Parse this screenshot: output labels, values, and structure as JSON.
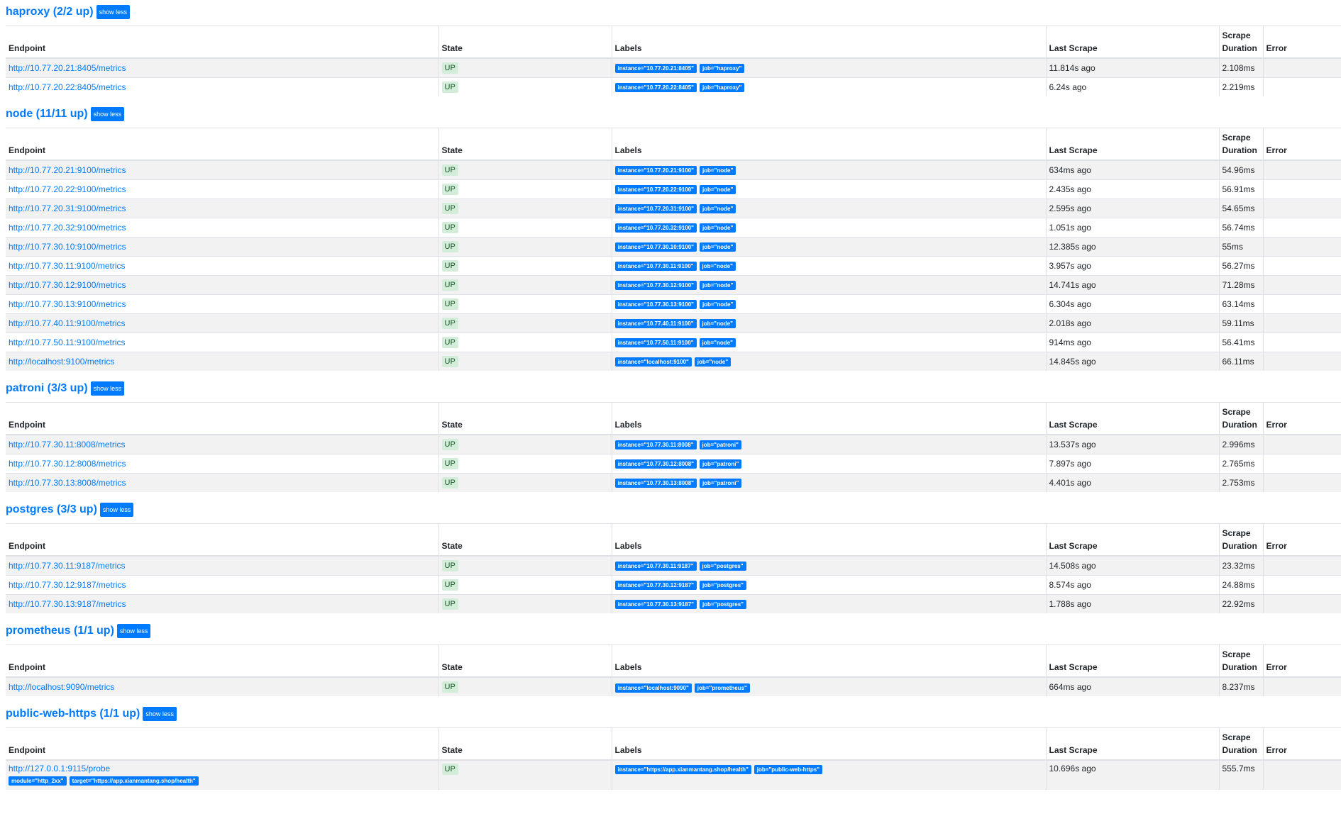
{
  "headers": {
    "endpoint": "Endpoint",
    "state": "State",
    "labels": "Labels",
    "last_scrape": "Last Scrape",
    "scrape_duration": "Scrape Duration",
    "error": "Error"
  },
  "toggle_label": "show less",
  "jobs": [
    {
      "title": "haproxy (2/2 up)",
      "rows": [
        {
          "endpoint": "http://10.77.20.21:8405/metrics",
          "state": "UP",
          "labels": [
            "instance=\"10.77.20.21:8405\"",
            "job=\"haproxy\""
          ],
          "last": "11.814s ago",
          "dur": "2.108ms"
        },
        {
          "endpoint": "http://10.77.20.22:8405/metrics",
          "state": "UP",
          "labels": [
            "instance=\"10.77.20.22:8405\"",
            "job=\"haproxy\""
          ],
          "last": "6.24s ago",
          "dur": "2.219ms"
        }
      ]
    },
    {
      "title": "node (11/11 up)",
      "rows": [
        {
          "endpoint": "http://10.77.20.21:9100/metrics",
          "state": "UP",
          "labels": [
            "instance=\"10.77.20.21:9100\"",
            "job=\"node\""
          ],
          "last": "634ms ago",
          "dur": "54.96ms"
        },
        {
          "endpoint": "http://10.77.20.22:9100/metrics",
          "state": "UP",
          "labels": [
            "instance=\"10.77.20.22:9100\"",
            "job=\"node\""
          ],
          "last": "2.435s ago",
          "dur": "56.91ms"
        },
        {
          "endpoint": "http://10.77.20.31:9100/metrics",
          "state": "UP",
          "labels": [
            "instance=\"10.77.20.31:9100\"",
            "job=\"node\""
          ],
          "last": "2.595s ago",
          "dur": "54.65ms"
        },
        {
          "endpoint": "http://10.77.20.32:9100/metrics",
          "state": "UP",
          "labels": [
            "instance=\"10.77.20.32:9100\"",
            "job=\"node\""
          ],
          "last": "1.051s ago",
          "dur": "56.74ms"
        },
        {
          "endpoint": "http://10.77.30.10:9100/metrics",
          "state": "UP",
          "labels": [
            "instance=\"10.77.30.10:9100\"",
            "job=\"node\""
          ],
          "last": "12.385s ago",
          "dur": "55ms"
        },
        {
          "endpoint": "http://10.77.30.11:9100/metrics",
          "state": "UP",
          "labels": [
            "instance=\"10.77.30.11:9100\"",
            "job=\"node\""
          ],
          "last": "3.957s ago",
          "dur": "56.27ms"
        },
        {
          "endpoint": "http://10.77.30.12:9100/metrics",
          "state": "UP",
          "labels": [
            "instance=\"10.77.30.12:9100\"",
            "job=\"node\""
          ],
          "last": "14.741s ago",
          "dur": "71.28ms"
        },
        {
          "endpoint": "http://10.77.30.13:9100/metrics",
          "state": "UP",
          "labels": [
            "instance=\"10.77.30.13:9100\"",
            "job=\"node\""
          ],
          "last": "6.304s ago",
          "dur": "63.14ms"
        },
        {
          "endpoint": "http://10.77.40.11:9100/metrics",
          "state": "UP",
          "labels": [
            "instance=\"10.77.40.11:9100\"",
            "job=\"node\""
          ],
          "last": "2.018s ago",
          "dur": "59.11ms"
        },
        {
          "endpoint": "http://10.77.50.11:9100/metrics",
          "state": "UP",
          "labels": [
            "instance=\"10.77.50.11:9100\"",
            "job=\"node\""
          ],
          "last": "914ms ago",
          "dur": "56.41ms"
        },
        {
          "endpoint": "http://localhost:9100/metrics",
          "state": "UP",
          "labels": [
            "instance=\"localhost:9100\"",
            "job=\"node\""
          ],
          "last": "14.845s ago",
          "dur": "66.11ms"
        }
      ]
    },
    {
      "title": "patroni (3/3 up)",
      "rows": [
        {
          "endpoint": "http://10.77.30.11:8008/metrics",
          "state": "UP",
          "labels": [
            "instance=\"10.77.30.11:8008\"",
            "job=\"patroni\""
          ],
          "last": "13.537s ago",
          "dur": "2.996ms"
        },
        {
          "endpoint": "http://10.77.30.12:8008/metrics",
          "state": "UP",
          "labels": [
            "instance=\"10.77.30.12:8008\"",
            "job=\"patroni\""
          ],
          "last": "7.897s ago",
          "dur": "2.765ms"
        },
        {
          "endpoint": "http://10.77.30.13:8008/metrics",
          "state": "UP",
          "labels": [
            "instance=\"10.77.30.13:8008\"",
            "job=\"patroni\""
          ],
          "last": "4.401s ago",
          "dur": "2.753ms"
        }
      ]
    },
    {
      "title": "postgres (3/3 up)",
      "rows": [
        {
          "endpoint": "http://10.77.30.11:9187/metrics",
          "state": "UP",
          "labels": [
            "instance=\"10.77.30.11:9187\"",
            "job=\"postgres\""
          ],
          "last": "14.508s ago",
          "dur": "23.32ms"
        },
        {
          "endpoint": "http://10.77.30.12:9187/metrics",
          "state": "UP",
          "labels": [
            "instance=\"10.77.30.12:9187\"",
            "job=\"postgres\""
          ],
          "last": "8.574s ago",
          "dur": "24.88ms"
        },
        {
          "endpoint": "http://10.77.30.13:9187/metrics",
          "state": "UP",
          "labels": [
            "instance=\"10.77.30.13:9187\"",
            "job=\"postgres\""
          ],
          "last": "1.788s ago",
          "dur": "22.92ms"
        }
      ]
    },
    {
      "title": "prometheus (1/1 up)",
      "rows": [
        {
          "endpoint": "http://localhost:9090/metrics",
          "state": "UP",
          "labels": [
            "instance=\"localhost:9090\"",
            "job=\"prometheus\""
          ],
          "last": "664ms ago",
          "dur": "8.237ms"
        }
      ]
    },
    {
      "title": "public-web-https (1/1 up)",
      "rows": [
        {
          "endpoint": "http://127.0.0.1:9115/probe",
          "endpoint_labels": [
            "module=\"http_2xx\"",
            "target=\"https://app.xianmantang.shop/health\""
          ],
          "state": "UP",
          "labels": [
            "instance=\"https://app.xianmantang.shop/health\"",
            "job=\"public-web-https\""
          ],
          "last": "10.696s ago",
          "dur": "555.7ms"
        }
      ]
    }
  ],
  "colors": {
    "link": "#007bff",
    "label_bg": "#007bff",
    "state_bg": "#d4edda",
    "state_fg": "#155724",
    "row_stripe": "#f2f2f2"
  }
}
